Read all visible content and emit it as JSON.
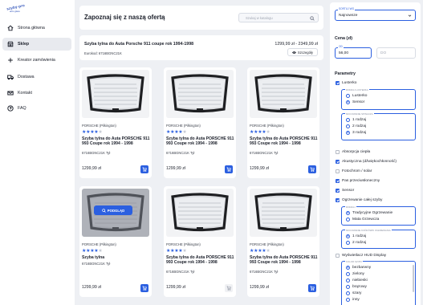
{
  "logo": {
    "line1": "szyby-pro",
    "line2": "auto glass"
  },
  "sidebar": {
    "items": [
      {
        "label": "Strona główna",
        "icon": "home-icon",
        "active": false
      },
      {
        "label": "Sklep",
        "icon": "shop-icon",
        "active": true
      },
      {
        "label": "Kreator zamówienia",
        "icon": "plus-icon",
        "active": false
      },
      {
        "label": "Dostawa",
        "icon": "truck-icon",
        "active": false
      },
      {
        "label": "Kontakt",
        "icon": "mail-icon",
        "active": false
      },
      {
        "label": "FAQ",
        "icon": "help-circle-icon",
        "active": false
      }
    ]
  },
  "header": {
    "title": "Zapoznaj się z naszą ofertą",
    "search_placeholder": "Szukaj w katalogu"
  },
  "info": {
    "title": "Szyba tylna do Auta Porsche 911 coupe rok 1994-1998",
    "price_range": "1299,99 zł - 2349,99 zł",
    "code": "Eurokod: 6716BGNC21K",
    "details_label": "Szczegóły"
  },
  "products": [
    {
      "brand": "PORSCHE (Pilkington)",
      "rating": 4,
      "name": "Szyba tylna do Auta PORSCHE 911 993 Coupe rok 1994 - 1998",
      "code": "6716BGNC21K Tył",
      "price": "1299,99 zł",
      "cart_enabled": true,
      "hover": false
    },
    {
      "brand": "PORSCHE (Pilkington)",
      "rating": 4,
      "name": "Szyba tylna do Auta PORSCHE 911 993 Coupe rok 1994 - 1998",
      "code": "6716BGNC21K Tył",
      "price": "1299,99 zł",
      "cart_enabled": true,
      "hover": false
    },
    {
      "brand": "PORSCHE (Pilkington)",
      "rating": 4,
      "name": "Szyba tylna do Auta PORSCHE 911 993 Coupe rok 1994 - 1998",
      "code": "6716BGNC21K Tył",
      "price": "1299,99 zł",
      "cart_enabled": true,
      "hover": false
    },
    {
      "brand": "PORSCHE (Pilkington)",
      "rating": 4,
      "name": "Szyba tylna",
      "code": "6716BGNC21K Tył",
      "price": "1299,99 zł",
      "cart_enabled": true,
      "hover": true,
      "zoom_label": "PODGLĄD"
    },
    {
      "brand": "PORSCHE (Pilkington)",
      "rating": 4,
      "name": "Szyba tylna do Auta PORSCHE 911 993 Coupe rok 1994 - 1998",
      "code": "6716BGNC21K Tył",
      "price": "1299,99 zł",
      "cart_enabled": false,
      "hover": false
    },
    {
      "brand": "PORSCHE (Pilkington)",
      "rating": 4,
      "name": "Szyba tylna do Auta PORSCHE 911 993 Coupe rok 1994 - 1998",
      "code": "6716BGNC21K Tył",
      "price": "1299,99 zł",
      "cart_enabled": true,
      "hover": false
    }
  ],
  "filters": {
    "sort_label": "SORTUJ WG",
    "sort_value": "Najnowsze",
    "price_heading": "Cena (zł)",
    "price_from_label": "OD",
    "price_from": "56,00",
    "price_to": "DO",
    "params_heading": "Parametry",
    "mirror": {
      "label": "Lusterko",
      "checked": true
    },
    "mirror_group": {
      "legend": "RODZAJ LUSTERKA",
      "options": [
        {
          "label": "Lusterko",
          "on": false
        },
        {
          "label": "Sensor",
          "on": true
        }
      ]
    },
    "wiper_group": {
      "legend": "MOCOWANIE SPINACZA",
      "options": [
        {
          "label": "1 rodzaj",
          "on": false
        },
        {
          "label": "2 rodzaj",
          "on": false
        },
        {
          "label": "3 rodzaj",
          "on": true
        }
      ]
    },
    "checks": [
      {
        "label": "Absorpcja ciepła",
        "checked": false
      },
      {
        "label": "Akustyczna (dźwiękochłonność)",
        "checked": true
      },
      {
        "label": "Fotochrom / solar",
        "checked": false
      },
      {
        "label": "Pas przeciwsłoneczny",
        "checked": true
      },
      {
        "label": "Sensor",
        "checked": true
      },
      {
        "label": "Ogrzewanie całej szyby",
        "checked": true
      }
    ],
    "heating_group": {
      "legend": "RODZAJ",
      "options": [
        {
          "label": "Tradycyjne Ogrzewanie",
          "on": true
        },
        {
          "label": "Mata Grzewcza",
          "on": false
        }
      ]
    },
    "mount_group": {
      "legend": "MOCOWANIE KOŃCÓWKI OGRZEWANIA",
      "options": [
        {
          "label": "1 rodzaj",
          "on": true
        },
        {
          "label": "2 rodzaj",
          "on": false
        }
      ]
    },
    "hud": {
      "label": "Wyświetlacz HUD Display",
      "checked": false
    },
    "color_group": {
      "legend": "KOLOR SZYBY",
      "options": [
        {
          "label": "bezbarwny",
          "on": true
        },
        {
          "label": "zielony",
          "on": false
        },
        {
          "label": "niebieski",
          "on": false
        },
        {
          "label": "brązowy",
          "on": false
        },
        {
          "label": "szary",
          "on": false
        },
        {
          "label": "inny",
          "on": false
        }
      ]
    }
  },
  "colors": {
    "accent": "#2b5fe0",
    "background": "#eef0f4"
  }
}
